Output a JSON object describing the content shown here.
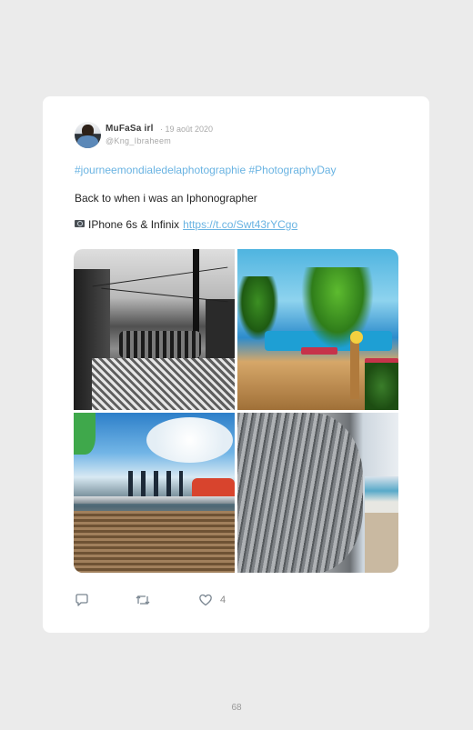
{
  "tweet": {
    "author_name": "MuFaSa irl",
    "date": "· 19 août 2020",
    "handle": "@Kng_Ibraheem",
    "hashtags": "#journeemondialedelaphotographie #PhotographyDay",
    "text": "Back to when i was an Iphonographer",
    "device_text": "IPhone 6s & Infinix",
    "link": "https://t.co/Swt43rYCgo",
    "link_display": "https://t.co/Swt43rYCgo",
    "likes": "4",
    "icons": {
      "reply": "reply-icon",
      "retweet": "retweet-icon",
      "like": "heart-icon",
      "camera": "camera-emoji-icon"
    },
    "colors": {
      "link": "#69b3e2",
      "background": "#ebebeb",
      "card": "#ffffff"
    }
  },
  "page": {
    "number": "68"
  }
}
